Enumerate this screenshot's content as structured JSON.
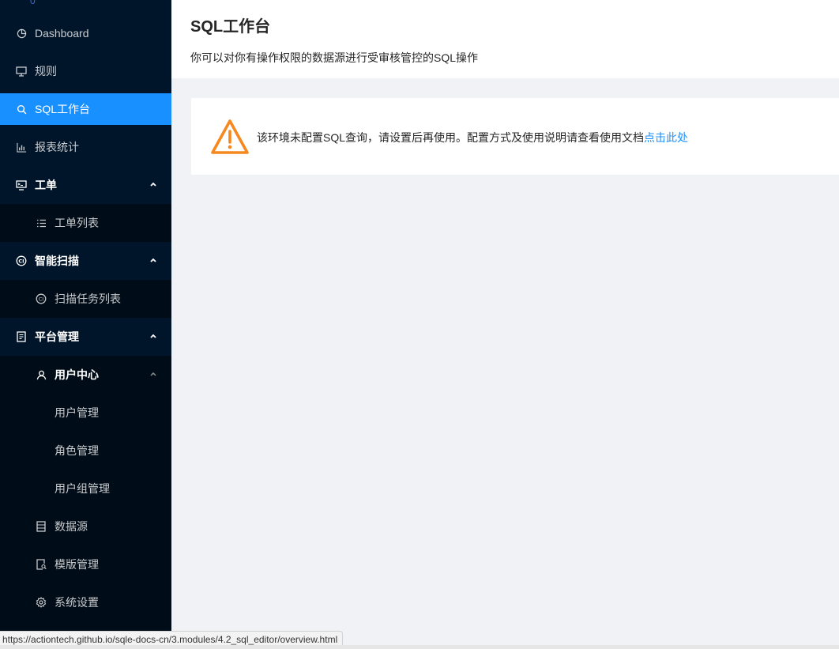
{
  "sidebar": {
    "top_stub": "0",
    "items": {
      "dashboard": "Dashboard",
      "rules": "规则",
      "sql_workbench": "SQL工作台",
      "reports": "报表统计",
      "orders": "工单",
      "order_list": "工单列表",
      "smart_scan": "智能扫描",
      "scan_task_list": "扫描任务列表",
      "platform_management": "平台管理",
      "user_center": "用户中心",
      "user_management": "用户管理",
      "role_management": "角色管理",
      "user_group_management": "用户组管理",
      "data_source": "数据源",
      "template_management": "模版管理",
      "system_settings": "系统设置"
    }
  },
  "main": {
    "title": "SQL工作台",
    "description": "你可以对你有操作权限的数据源进行受审核管控的SQL操作",
    "alert": {
      "message": "该环境未配置SQL查询，请设置后再使用。配置方式及使用说明请查看使用文档",
      "link_text": "点击此处"
    }
  },
  "status_bar": {
    "url": "https://actiontech.github.io/sqle-docs-cn/3.modules/4.2_sql_editor/overview.html"
  },
  "colors": {
    "sidebar_bg": "#001529",
    "submenu_bg": "#000c17",
    "accent": "#1890ff",
    "warning": "#f5891f"
  },
  "icons": {
    "dashboard": "pie-chart-icon",
    "rules": "desktop-icon",
    "sql_workbench": "search-icon",
    "reports": "bar-chart-icon",
    "orders": "console-icon",
    "order_list": "unordered-list-icon",
    "smart_scan": "ci-icon",
    "scan_task_list": "ci-icon",
    "platform_management": "audit-icon",
    "user_center": "user-icon",
    "data_source": "database-icon",
    "template_management": "file-search-icon",
    "system_settings": "setting-icon",
    "alert": "warning-icon"
  }
}
